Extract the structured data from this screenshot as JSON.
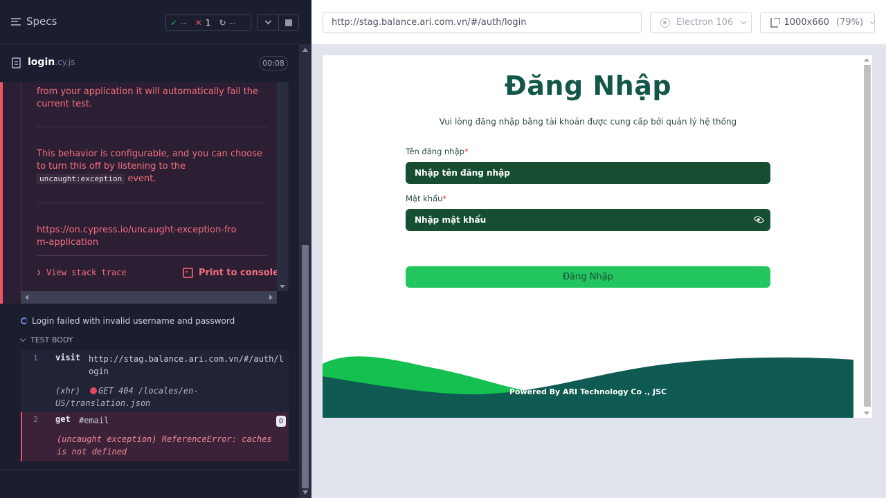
{
  "reporter": {
    "specs_label": "Specs",
    "stats": {
      "passed": "--",
      "failed": "1",
      "pending": "--"
    },
    "spec": {
      "name": "login",
      "ext": ".cy.js",
      "duration": "00:08"
    },
    "error": {
      "line1": "from your application it will automatically fail the",
      "line2": "current test.",
      "para2a": "This behavior is configurable, and you can choose to turn this off by listening to the",
      "code": "uncaught:exception",
      "para2b": "event.",
      "link": "https://on.cypress.io/uncaught-exception-from-application",
      "view_stack": "View stack trace",
      "print_console": "Print to console"
    },
    "test_title": "Login failed with invalid username and password",
    "test_body": "TEST BODY",
    "commands": [
      {
        "num": "1",
        "name": "visit",
        "message": "http://stag.balance.ari.com.vn/#/auth/login",
        "log_prefix": "(xhr)",
        "log_text": "GET 404 /locales/en-US/translation.json"
      },
      {
        "num": "2",
        "name": "get",
        "message": "#email",
        "badge": "0",
        "log_text": "(uncaught exception)  ReferenceError: caches is not defined"
      }
    ]
  },
  "aut": {
    "url": "http://stag.balance.ari.com.vn/#/auth/login",
    "browser": "Electron 106",
    "viewport": "1000x660",
    "zoom": "(79%)",
    "login": {
      "title": "Đăng Nhập",
      "subtitle": "Vui lòng đăng nhập bằng tài khoản được cung cấp bởi quản lý hệ thống",
      "username_label": "Tên đăng nhập",
      "username_placeholder": "Nhập tên đăng nhập",
      "password_label": "Mật khẩu",
      "password_placeholder": "Nhập mật khẩu",
      "required_mark": "*",
      "submit": "Đăng Nhập",
      "footer": "Powered By ARI Technology Co ., JSC"
    }
  },
  "colors": {
    "reporter_bg": "#1b1e2e",
    "fail": "#f0546c",
    "pass": "#22c05d",
    "brand_dark_green": "#13574a",
    "input_green": "#174d30",
    "button_green": "#22c55e",
    "wave_teal": "#0f5a52",
    "wave_green": "#14c04f"
  }
}
